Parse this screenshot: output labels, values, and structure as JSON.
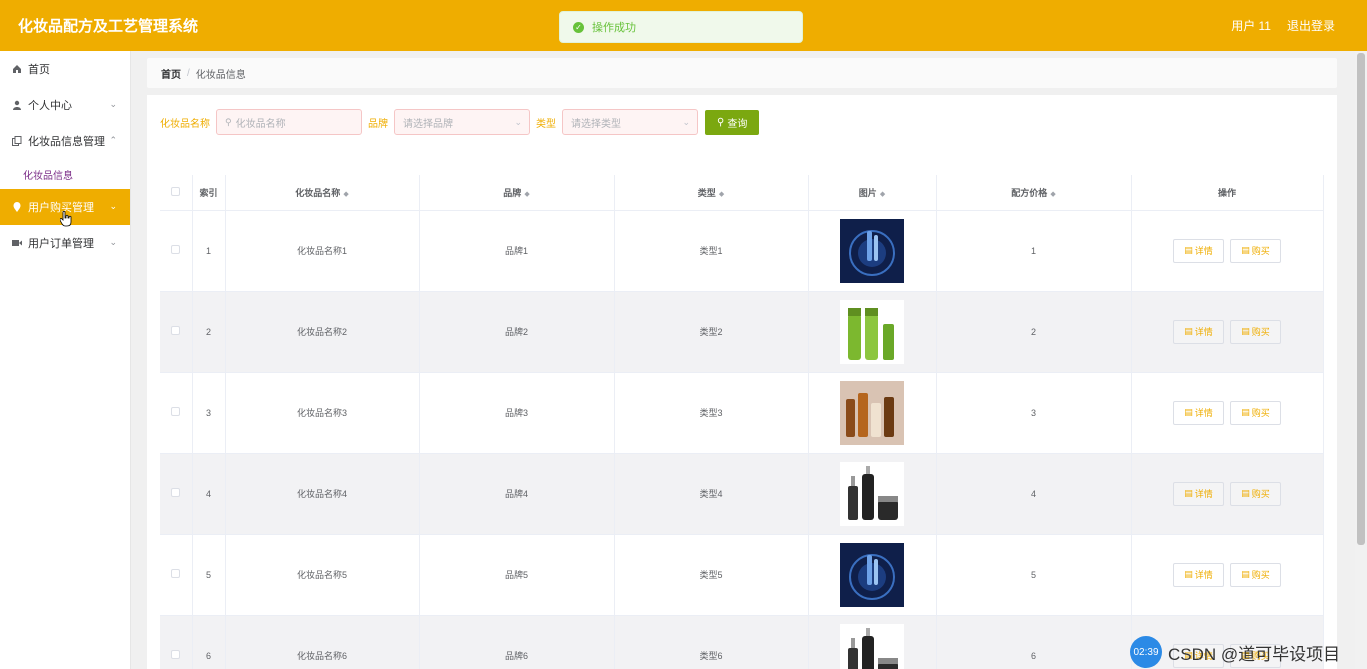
{
  "header": {
    "title": "化妆品配方及工艺管理系统",
    "user": "用户 11",
    "logout": "退出登录"
  },
  "toast": {
    "message": "操作成功"
  },
  "sidebar": {
    "items": [
      {
        "label": "首页",
        "icon": "home-icon"
      },
      {
        "label": "个人中心",
        "icon": "user-icon"
      },
      {
        "label": "化妆品信息管理",
        "icon": "copy-icon"
      },
      {
        "label": "化妆品信息",
        "icon": ""
      },
      {
        "label": "用户购买管理",
        "icon": "location-icon"
      },
      {
        "label": "用户订单管理",
        "icon": "video-icon"
      }
    ]
  },
  "breadcrumb": {
    "home": "首页",
    "separator": "/",
    "current": "化妆品信息"
  },
  "search": {
    "name_label": "化妆品名称",
    "name_placeholder": "化妆品名称",
    "brand_label": "品牌",
    "brand_placeholder": "请选择品牌",
    "type_label": "类型",
    "type_placeholder": "请选择类型",
    "query_button": "查询"
  },
  "table": {
    "headers": [
      "索引",
      "化妆品名称",
      "品牌",
      "类型",
      "图片",
      "配方价格",
      "操作"
    ],
    "detail_label": "详情",
    "buy_label": "购买",
    "rows": [
      {
        "index": "1",
        "name": "化妆品名称1",
        "brand": "品牌1",
        "type": "类型1",
        "price": "1",
        "image": "blue-serum-product"
      },
      {
        "index": "2",
        "name": "化妆品名称2",
        "brand": "品牌2",
        "type": "类型2",
        "price": "2",
        "image": "green-bottles-product"
      },
      {
        "index": "3",
        "name": "化妆品名称3",
        "brand": "品牌3",
        "type": "类型3",
        "price": "3",
        "image": "amber-bottles-product"
      },
      {
        "index": "4",
        "name": "化妆品名称4",
        "brand": "品牌4",
        "type": "类型4",
        "price": "4",
        "image": "black-bottles-product"
      },
      {
        "index": "5",
        "name": "化妆品名称5",
        "brand": "品牌5",
        "type": "类型5",
        "price": "5",
        "image": "blue-serum-product"
      },
      {
        "index": "6",
        "name": "化妆品名称6",
        "brand": "品牌6",
        "type": "类型6",
        "price": "6",
        "image": "black-bottles-product"
      }
    ]
  },
  "watermark": {
    "time": "02:39",
    "text": "CSDN @道可毕设项目"
  },
  "colors": {
    "accent": "#efad00",
    "query_button": "#7ba810",
    "success": "#67c23a"
  }
}
